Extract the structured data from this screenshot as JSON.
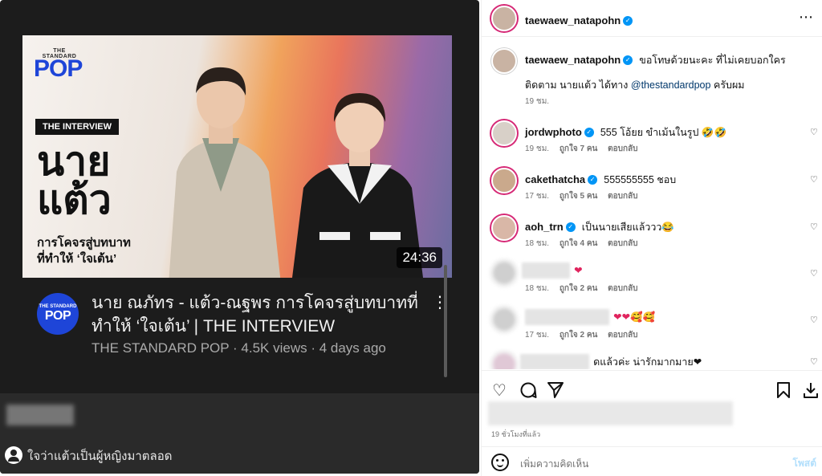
{
  "video": {
    "logo_small": "THE STANDARD",
    "logo_main": "POP",
    "tag": "THE INTERVIEW",
    "headline_line1": "นาย",
    "headline_line2": "แต้ว",
    "sub_line1": "การโคจรสู่บทบาท",
    "sub_line2": "ที่ทำให้ ‘ใจเต้น’",
    "duration": "24:36",
    "channel_avatar_small": "THE STANDARD",
    "channel_avatar_main": "POP",
    "title": "นาย ณภัทร - แต้ว-ณฐพร การโคจรสู่บทบาทที่ทำให้ ‘ใจเต้น’ | THE INTERVIEW",
    "meta": "THE STANDARD POP · 4.5K views · 4 days ago",
    "more_icon": "⋮"
  },
  "left_bottom": {
    "comment_text": "ใจว่าแต้วเป็นผู้หญิงมาตลอด"
  },
  "post": {
    "author": "taewaew_natapohn",
    "caption": {
      "username": "taewaew_natapohn",
      "text": "ขอโทษด้วยนะคะ ที่ไม่เคยบอกใคร",
      "line2_prefix": "ติดตาม นายแต้ว ได้ทาง",
      "mention": "@thestandardpop",
      "line2_suffix": "ครับผม",
      "time": "19 ชม."
    },
    "comments": [
      {
        "username": "jordwphoto",
        "text": "555 โอ้ยย ขำเม้นในรูป 🤣🤣",
        "time": "19 ชม.",
        "likes": "ถูกใจ 7 คน",
        "reply": "ตอบกลับ"
      },
      {
        "username": "cakethatcha",
        "text": "555555555 ชอบ",
        "time": "17 ชม.",
        "likes": "ถูกใจ 5 คน",
        "reply": "ตอบกลับ"
      },
      {
        "username": "aoh_trn",
        "text": "เป็นนายเสียแล้ววว😂",
        "time": "18 ชม.",
        "likes": "ถูกใจ 4 คน",
        "reply": "ตอบกลับ"
      },
      {
        "username": "",
        "text": "❤",
        "time": "18 ชม.",
        "likes": "ถูกใจ 2 คน",
        "reply": "ตอบกลับ"
      },
      {
        "username": "",
        "text": "❤❤🥰🥰",
        "time": "17 ชม.",
        "likes": "ถูกใจ 2 คน",
        "reply": "ตอบกลับ"
      },
      {
        "username": "",
        "text": "ดแล้วค่ะ น่ารักมากมาย❤",
        "time": "",
        "likes": "",
        "reply": ""
      }
    ],
    "time_ago": "19 ชั่วโมงที่แล้ว",
    "add_comment_placeholder": "เพิ่มความคิดเห็น",
    "post_button": "โพสต์"
  },
  "icons": {
    "more": "⋯",
    "heart": "♡",
    "comment": "◯",
    "share": "➤",
    "save": "⊓",
    "download": "⤓"
  }
}
